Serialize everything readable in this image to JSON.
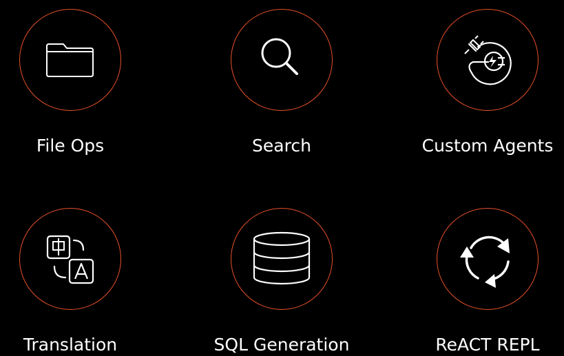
{
  "colors": {
    "background": "#000000",
    "ring": "#e8512a",
    "text": "#ffffff"
  },
  "tiles": [
    {
      "label": "File Ops",
      "icon": "folder-icon"
    },
    {
      "label": "Search",
      "icon": "search-icon"
    },
    {
      "label": "Custom Agents",
      "icon": "plug-icon"
    },
    {
      "label": "Translation",
      "icon": "translate-icon"
    },
    {
      "label": "SQL Generation",
      "icon": "database-icon"
    },
    {
      "label": "ReACT REPL",
      "icon": "cycle-arrows-icon"
    }
  ]
}
